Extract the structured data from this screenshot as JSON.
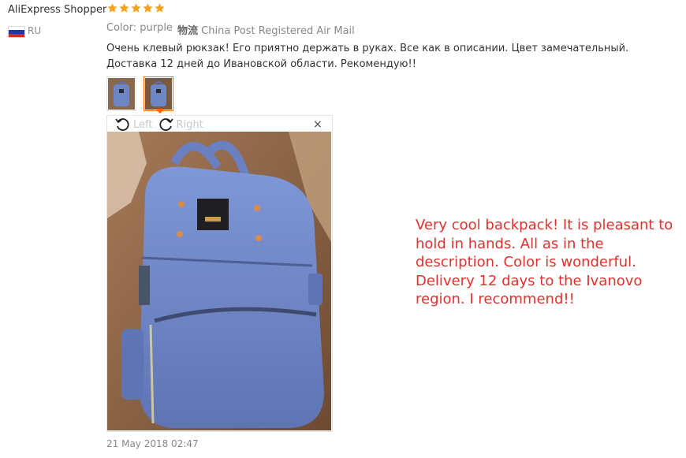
{
  "review": {
    "author": "AliExpress Shopper",
    "rating": 5,
    "country_code": "RU",
    "color_label": "Color: purple",
    "shipping_prefix": "物流",
    "shipping_method": "China Post Registered Air Mail",
    "text": "Очень клевый рюкзак! Его приятно держать в руках. Все как в описании. Цвет замечательный. Доставка 12 дней до Ивановской области. Рекомендую!!",
    "date": "21 May 2018 02:47"
  },
  "viewer": {
    "left_label": "Left",
    "right_label": "Right",
    "close_label": "×"
  },
  "translation": "Very cool backpack! It is pleasant to hold in hands. All as in the description. Color is wonderful. Delivery 12 days to the Ivanovo region. I recommend!!",
  "colors": {
    "star": "#f7a21a",
    "selected_border": "#ff6600",
    "translation_text": "#e0322d",
    "flag": [
      "#ffffff",
      "#1c3aa6",
      "#d52b1e"
    ]
  },
  "icons": [
    "star-icon",
    "rotate-left-icon",
    "rotate-right-icon",
    "close-icon"
  ]
}
